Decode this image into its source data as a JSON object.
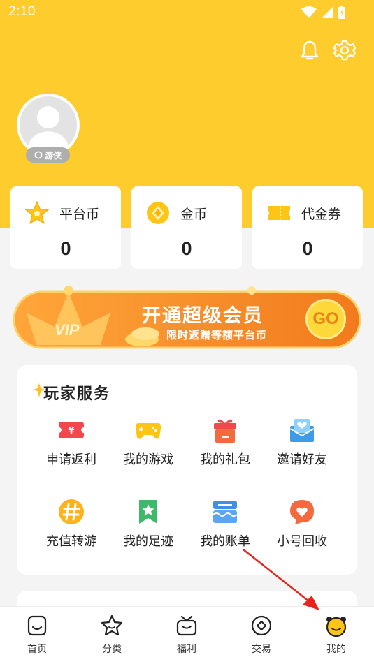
{
  "status_bar": {
    "time": "2:10"
  },
  "header": {
    "bell_icon": "bell-icon",
    "settings_icon": "gear-icon"
  },
  "profile": {
    "level_badge": "游侠"
  },
  "wallet": [
    {
      "label": "平台币",
      "value": "0",
      "icon": "star-icon",
      "color": "#ffc514"
    },
    {
      "label": "金币",
      "value": "0",
      "icon": "coin-icon",
      "color": "#ffc514"
    },
    {
      "label": "代金券",
      "value": "0",
      "icon": "ticket-icon",
      "color": "#ffc514"
    }
  ],
  "vip_banner": {
    "badge": "VIP",
    "title": "开通超级会员",
    "subtitle": "限时返赠等额平台币",
    "go_label": "GO"
  },
  "services": {
    "title": "玩家服务",
    "items": [
      {
        "label": "申请返利",
        "icon": "rebate-icon",
        "color": "#f0484c"
      },
      {
        "label": "我的游戏",
        "icon": "gamepad-icon",
        "color": "#ffc514"
      },
      {
        "label": "我的礼包",
        "icon": "gift-icon",
        "color": "#f26a3d"
      },
      {
        "label": "邀请好友",
        "icon": "invite-icon",
        "color": "#3d9be9"
      },
      {
        "label": "充值转游",
        "icon": "transfer-icon",
        "color": "#ffb21c"
      },
      {
        "label": "我的足迹",
        "icon": "bookmark-icon",
        "color": "#3fb86b"
      },
      {
        "label": "我的账单",
        "icon": "bill-icon",
        "color": "#3d8fe9"
      },
      {
        "label": "小号回收",
        "icon": "recycle-icon",
        "color": "#f26a3d"
      }
    ]
  },
  "bottom_nav": [
    {
      "label": "首页",
      "icon": "home-icon"
    },
    {
      "label": "分类",
      "icon": "category-icon"
    },
    {
      "label": "福利",
      "icon": "welfare-icon"
    },
    {
      "label": "交易",
      "icon": "trade-icon"
    },
    {
      "label": "我的",
      "icon": "mine-icon",
      "active": true
    }
  ],
  "colors": {
    "brand": "#ffcc2e",
    "active": "#ffc514",
    "annotation": "#e8231c"
  }
}
